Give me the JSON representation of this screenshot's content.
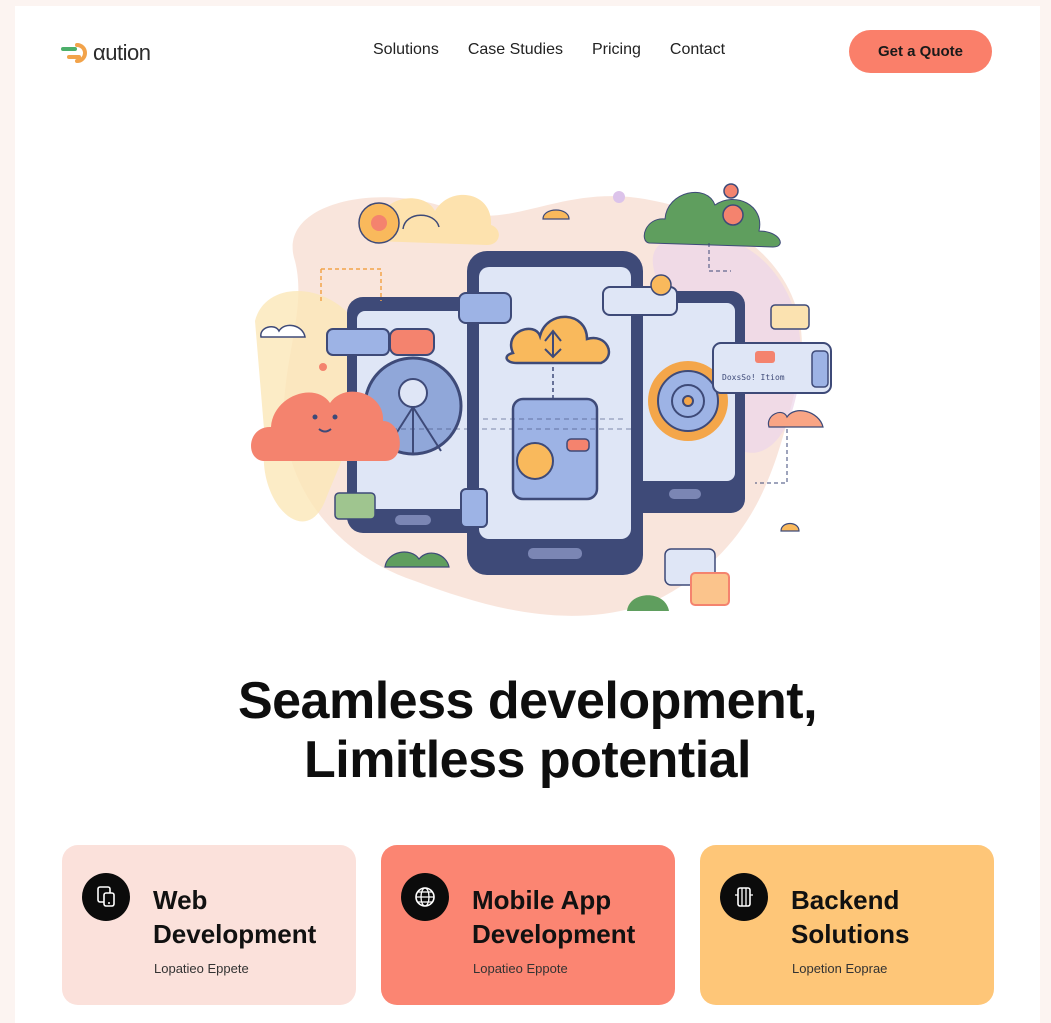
{
  "brand": {
    "name": "αution"
  },
  "nav": {
    "items": [
      "Solutions",
      "Case Studies",
      "Pricing",
      "Contact"
    ],
    "cta_label": "Get a Quote"
  },
  "hero": {
    "art_label": "DoxsSo! Itiom",
    "headline_line1": "Seamless development,",
    "headline_line2": "Limitless potential"
  },
  "cards": [
    {
      "title_line1": "Web",
      "title_line2": "Development",
      "subtitle": "Lopatieo Eppete",
      "icon": "device-icon",
      "color": "#fbe1db"
    },
    {
      "title_line1": "Mobile App",
      "title_line2": "Development",
      "subtitle": "Lopatieo Eppote",
      "icon": "globe-chip-icon",
      "color": "#fb8572"
    },
    {
      "title_line1": "Backend",
      "title_line2": "Solutions",
      "subtitle": "Lopetion Eoprae",
      "icon": "server-icon",
      "color": "#fec678"
    }
  ],
  "colors": {
    "accent": "#fa7f6a",
    "background": "#fcf4f1",
    "peach": "#fbe1db",
    "amber": "#fec678"
  }
}
